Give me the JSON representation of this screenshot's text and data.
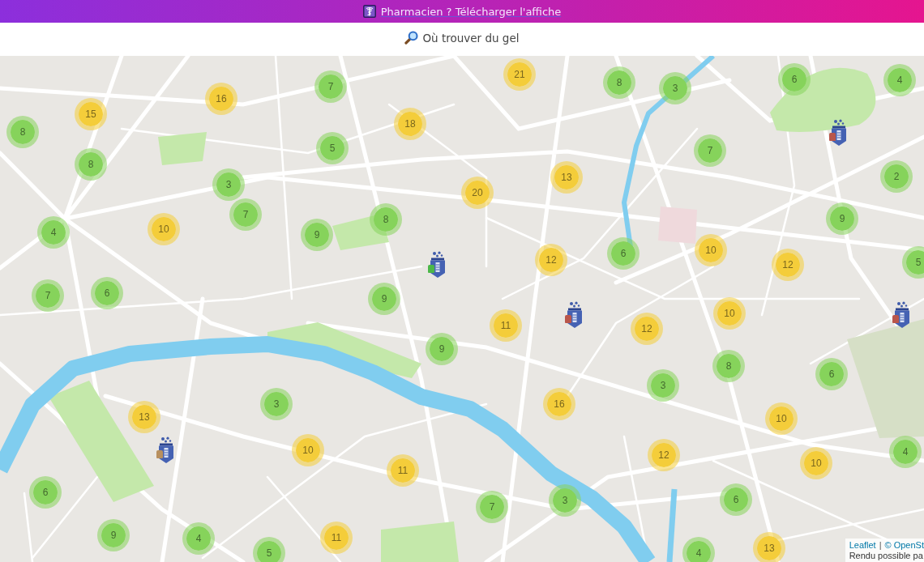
{
  "banner": {
    "link": "Pharmacien ? Télécharger l'affiche"
  },
  "heading": {
    "text": "Où trouver du gel"
  },
  "map": {
    "clusters": [
      {
        "count": "16",
        "color": "#f4cd3a"
      },
      {
        "count": "7",
        "color": "#86d35b"
      },
      {
        "count": "21",
        "color": "#f4cd3a"
      },
      {
        "count": "8",
        "color": "#86d35b"
      },
      {
        "count": "3",
        "color": "#86d35b"
      },
      {
        "count": "6",
        "color": "#86d35b"
      },
      {
        "count": "4",
        "color": "#86d35b"
      },
      {
        "count": "8",
        "color": "#86d35b"
      },
      {
        "count": "15",
        "color": "#f4cd3a"
      },
      {
        "count": "18",
        "color": "#f4cd3a"
      },
      {
        "count": "8",
        "color": "#86d35b"
      },
      {
        "count": "5",
        "color": "#86d35b"
      },
      {
        "count": "7",
        "color": "#86d35b"
      },
      {
        "count": "3",
        "color": "#86d35b"
      },
      {
        "count": "20",
        "color": "#f4cd3a"
      },
      {
        "count": "13",
        "color": "#f4cd3a"
      },
      {
        "count": "2",
        "color": "#86d35b"
      },
      {
        "count": "4",
        "color": "#86d35b"
      },
      {
        "count": "10",
        "color": "#f4cd3a"
      },
      {
        "count": "7",
        "color": "#86d35b"
      },
      {
        "count": "9",
        "color": "#86d35b"
      },
      {
        "count": "8",
        "color": "#86d35b"
      },
      {
        "count": "9",
        "color": "#86d35b"
      },
      {
        "count": "12",
        "color": "#f4cd3a"
      },
      {
        "count": "6",
        "color": "#86d35b"
      },
      {
        "count": "10",
        "color": "#f4cd3a"
      },
      {
        "count": "12",
        "color": "#f4cd3a"
      },
      {
        "count": "5",
        "color": "#86d35b"
      },
      {
        "count": "7",
        "color": "#86d35b"
      },
      {
        "count": "6",
        "color": "#86d35b"
      },
      {
        "count": "9",
        "color": "#86d35b"
      },
      {
        "count": "11",
        "color": "#f4cd3a"
      },
      {
        "count": "12",
        "color": "#f4cd3a"
      },
      {
        "count": "10",
        "color": "#f4cd3a"
      },
      {
        "count": "9",
        "color": "#86d35b"
      },
      {
        "count": "3",
        "color": "#86d35b"
      },
      {
        "count": "8",
        "color": "#86d35b"
      },
      {
        "count": "6",
        "color": "#86d35b"
      },
      {
        "count": "13",
        "color": "#f4cd3a"
      },
      {
        "count": "3",
        "color": "#86d35b"
      },
      {
        "count": "16",
        "color": "#f4cd3a"
      },
      {
        "count": "10",
        "color": "#f4cd3a"
      },
      {
        "count": "10",
        "color": "#f4cd3a"
      },
      {
        "count": "11",
        "color": "#f4cd3a"
      },
      {
        "count": "12",
        "color": "#f4cd3a"
      },
      {
        "count": "10",
        "color": "#f4cd3a"
      },
      {
        "count": "4",
        "color": "#86d35b"
      },
      {
        "count": "6",
        "color": "#86d35b"
      },
      {
        "count": "7",
        "color": "#86d35b"
      },
      {
        "count": "3",
        "color": "#86d35b"
      },
      {
        "count": "6",
        "color": "#86d35b"
      },
      {
        "count": "9",
        "color": "#86d35b"
      },
      {
        "count": "4",
        "color": "#86d35b"
      },
      {
        "count": "5",
        "color": "#86d35b"
      },
      {
        "count": "11",
        "color": "#f4cd3a"
      },
      {
        "count": "4",
        "color": "#86d35b"
      },
      {
        "count": "13",
        "color": "#f4cd3a"
      }
    ],
    "pharmacies": [
      {
        "color": "#b9564b"
      },
      {
        "color": "#4cb848"
      },
      {
        "color": "#b9564b"
      },
      {
        "color": "#b9564b"
      },
      {
        "color": "#b8905f"
      }
    ],
    "attribution": {
      "links": [
        {
          "text": "Leaflet"
        },
        {
          "text": "© OpenSt"
        }
      ],
      "separator": "|",
      "note": "Rendu possible pa"
    }
  }
}
